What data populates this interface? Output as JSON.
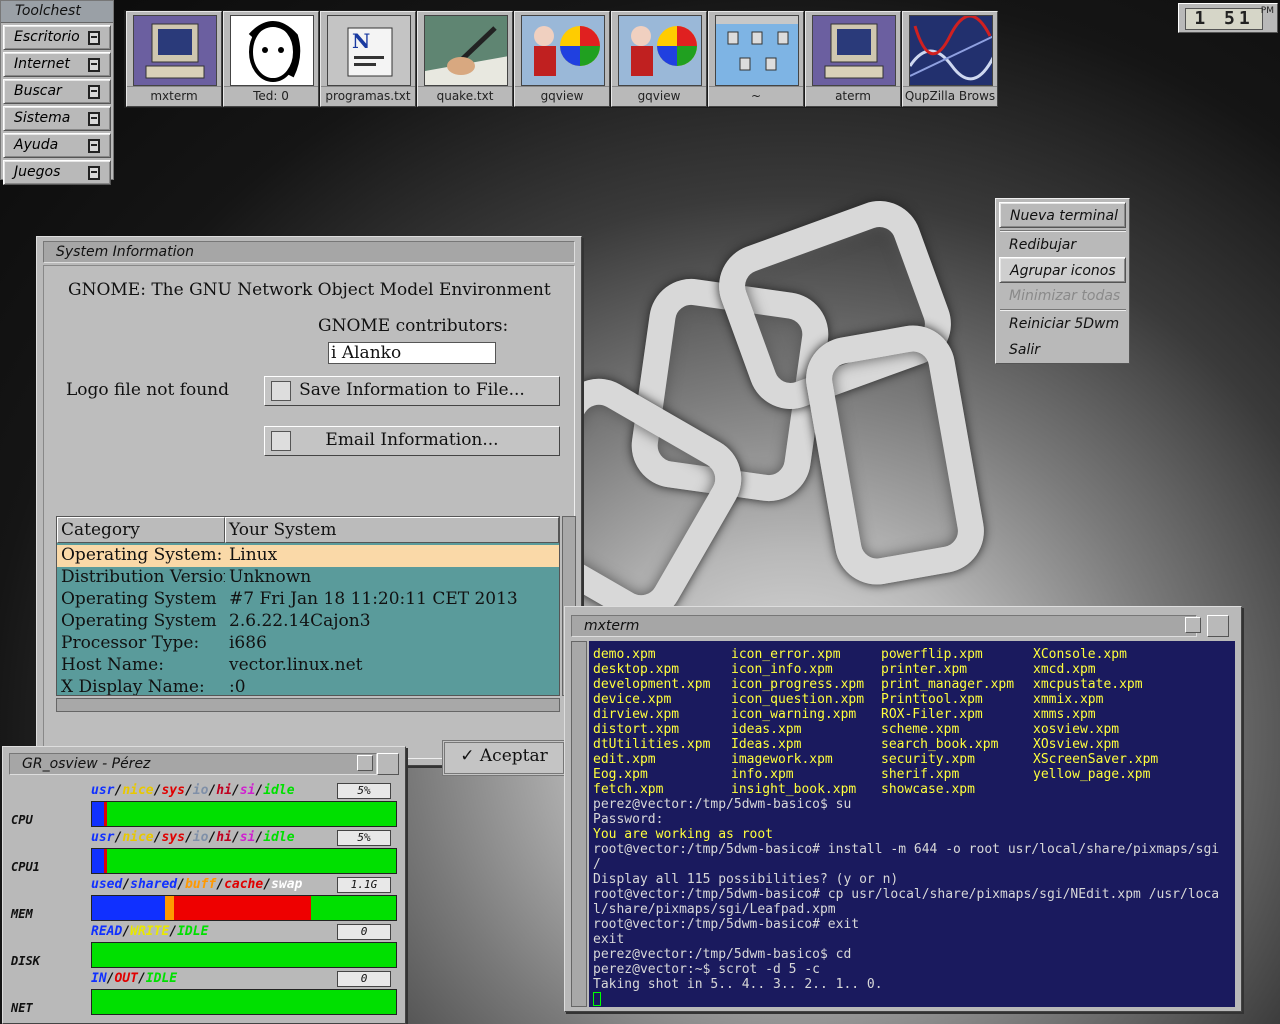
{
  "toolchest": {
    "title": "Toolchest",
    "items": [
      "Escritorio",
      "Internet",
      "Buscar",
      "Sistema",
      "Ayuda",
      "Juegos"
    ]
  },
  "iconbar": {
    "items": [
      {
        "label": "mxterm",
        "icon": "monitor-icon"
      },
      {
        "label": "Ted: 0",
        "icon": "portrait-icon"
      },
      {
        "label": "programas.txt",
        "icon": "document-n-icon"
      },
      {
        "label": "quake.txt",
        "icon": "pen-hand-icon"
      },
      {
        "label": "gqview",
        "icon": "color-wheel-icon"
      },
      {
        "label": "gqview",
        "icon": "color-wheel-icon"
      },
      {
        "label": "~",
        "icon": "folder-window-icon"
      },
      {
        "label": "aterm",
        "icon": "monitor-icon"
      },
      {
        "label": "QupZilla Brows",
        "icon": "globe-icon"
      }
    ]
  },
  "clock": {
    "time": "1 51",
    "ampm": "PM"
  },
  "root_menu": {
    "items": [
      "Nueva terminal",
      "Redibujar",
      "Agrupar iconos",
      "Minimizar todas",
      "Reiniciar 5Dwm",
      "Salir"
    ]
  },
  "sysinfo": {
    "title": "System Information",
    "heading": "GNOME: The GNU Network Object Model Environment",
    "contributors_label": "GNOME contributors:",
    "contributor_value": "i Alanko",
    "logo_text": "Logo file not found",
    "save_button": "Save Information to File...",
    "email_button": "Email Information...",
    "ok_button": "Aceptar",
    "columns": [
      "Category",
      "Your System"
    ],
    "rows": [
      {
        "category": "Operating System:",
        "value": "Linux"
      },
      {
        "category": "Distribution Version:",
        "value": "Unknown"
      },
      {
        "category": "Operating System",
        "value": "#7 Fri Jan 18 11:20:11 CET 2013"
      },
      {
        "category": "Operating System",
        "value": "2.6.22.14Cajon3"
      },
      {
        "category": "Processor Type:",
        "value": "i686"
      },
      {
        "category": "Host Name:",
        "value": "vector.linux.net"
      },
      {
        "category": "X Display Name:",
        "value": ":0"
      }
    ]
  },
  "osview": {
    "title": "GR_osview - Pérez",
    "meters": [
      {
        "name": "CPU",
        "legend": [
          "usr",
          "nice",
          "sys",
          "io",
          "hi",
          "si",
          "idle"
        ],
        "value": "5%",
        "segments": [
          {
            "color": "#1030ff",
            "fraction": 0.04
          },
          {
            "color": "#e00000",
            "fraction": 0.01
          },
          {
            "color": "#00e000",
            "fraction": 0.95
          }
        ]
      },
      {
        "name": "CPU1",
        "legend": [
          "usr",
          "nice",
          "sys",
          "io",
          "hi",
          "si",
          "idle"
        ],
        "value": "5%",
        "segments": [
          {
            "color": "#1030ff",
            "fraction": 0.04
          },
          {
            "color": "#e00000",
            "fraction": 0.01
          },
          {
            "color": "#00e000",
            "fraction": 0.95
          }
        ]
      },
      {
        "name": "MEM",
        "legend": [
          "used",
          "shared",
          "buff",
          "cache",
          "swap"
        ],
        "value": "1.1G",
        "segments": [
          {
            "color": "#1030ff",
            "fraction": 0.24
          },
          {
            "color": "#ff9900",
            "fraction": 0.03
          },
          {
            "color": "#ee0000",
            "fraction": 0.45
          },
          {
            "color": "#00e000",
            "fraction": 0.28
          }
        ]
      },
      {
        "name": "DISK",
        "legend": [
          "READ",
          "WRITE",
          "IDLE"
        ],
        "value": "0",
        "segments": [
          {
            "color": "#00e000",
            "fraction": 1.0
          }
        ]
      },
      {
        "name": "NET",
        "legend": [
          "IN",
          "OUT",
          "IDLE"
        ],
        "value": "0",
        "segments": [
          {
            "color": "#00e000",
            "fraction": 1.0
          }
        ]
      }
    ]
  },
  "mxterm": {
    "title": "mxterm",
    "file_columns": [
      [
        "demo.xpm",
        "desktop.xpm",
        "development.xpm",
        "device.xpm",
        "dirview.xpm",
        "distort.xpm",
        "dtUtilities.xpm",
        "edit.xpm",
        "Eog.xpm",
        "fetch.xpm"
      ],
      [
        "icon_error.xpm",
        "icon_info.xpm",
        "icon_progress.xpm",
        "icon_question.xpm",
        "icon_warning.xpm",
        "ideas.xpm",
        "Ideas.xpm",
        "imagework.xpm",
        "info.xpm",
        "insight_book.xpm"
      ],
      [
        "powerflip.xpm",
        "printer.xpm",
        "print_manager.xpm",
        "Printtool.xpm",
        "ROX-Filer.xpm",
        "scheme.xpm",
        "search_book.xpm",
        "security.xpm",
        "sherif.xpm",
        "showcase.xpm"
      ],
      [
        "XConsole.xpm",
        "xmcd.xpm",
        "xmcpustate.xpm",
        "xmmix.xpm",
        "xmms.xpm",
        "xosview.xpm",
        "XOsview.xpm",
        "XScreenSaver.xpm",
        "yellow_page.xpm"
      ]
    ],
    "lines": [
      {
        "text": "perez@vector:/tmp/5dwm-basico$ su",
        "color": "#d8d8d8"
      },
      {
        "text": "Password:",
        "color": "#d8d8d8"
      },
      {
        "text": "You are working as root",
        "color": "#ffff3c"
      },
      {
        "text": "root@vector:/tmp/5dwm-basico# install -m 644 -o root usr/local/share/pixmaps/sgi",
        "color": "#d8d8d8"
      },
      {
        "text": "/",
        "color": "#d8d8d8"
      },
      {
        "text": "Display all 115 possibilities? (y or n)",
        "color": "#d8d8d8"
      },
      {
        "text": "root@vector:/tmp/5dwm-basico# cp usr/local/share/pixmaps/sgi/NEdit.xpm /usr/loca",
        "color": "#d8d8d8"
      },
      {
        "text": "l/share/pixmaps/sgi/Leafpad.xpm",
        "color": "#d8d8d8"
      },
      {
        "text": "root@vector:/tmp/5dwm-basico# exit",
        "color": "#d8d8d8"
      },
      {
        "text": "exit",
        "color": "#d8d8d8"
      },
      {
        "text": "perez@vector:/tmp/5dwm-basico$ cd",
        "color": "#d8d8d8"
      },
      {
        "text": "perez@vector:~$ scrot -d 5 -c",
        "color": "#d8d8d8"
      },
      {
        "text": "Taking shot in 5.. 4.. 3.. 2.. 1.. 0.",
        "color": "#d8d8d8"
      }
    ]
  }
}
